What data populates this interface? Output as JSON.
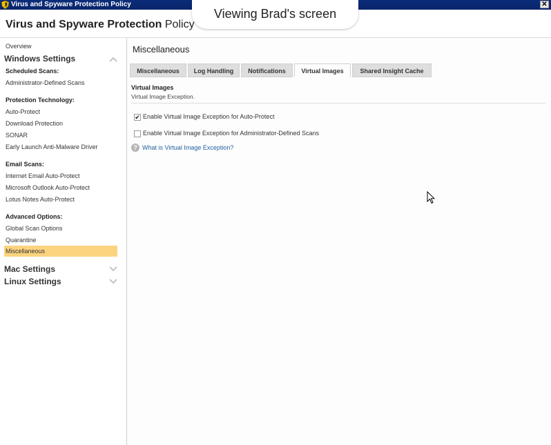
{
  "window": {
    "title": "Virus and Spyware Protection Policy",
    "close_glyph": "✕"
  },
  "header": {
    "title_bold": "Virus and Spyware Protection",
    "title_rest": " Policy"
  },
  "overlay": {
    "viewing_text": "Viewing Brad's screen"
  },
  "sidebar": {
    "overview": "Overview",
    "windows_settings": "Windows Settings",
    "scheduled_scans_head": "Scheduled Scans:",
    "admin_defined_scans": "Administrator-Defined Scans",
    "protection_tech_head": "Protection Technology:",
    "auto_protect": "Auto-Protect",
    "download_protection": "Download Protection",
    "sonar": "SONAR",
    "elam": "Early Launch Anti-Malware Driver",
    "email_scans_head": "Email Scans:",
    "internet_email": "Internet Email Auto-Protect",
    "outlook": "Microsoft Outlook Auto-Protect",
    "lotus": "Lotus Notes Auto-Protect",
    "advanced_head": "Advanced Options:",
    "global_scan": "Global Scan Options",
    "quarantine": "Quarantine",
    "miscellaneous": "Miscellaneous",
    "mac_settings": "Mac Settings",
    "linux_settings": "Linux Settings"
  },
  "main": {
    "heading": "Miscellaneous",
    "tabs": [
      {
        "label": "Miscellaneous"
      },
      {
        "label": "Log Handling"
      },
      {
        "label": "Notifications"
      },
      {
        "label": "Virtual Images"
      },
      {
        "label": "Shared Insight Cache"
      }
    ],
    "active_tab": "Virtual Images",
    "section_title": "Virtual Images",
    "section_desc": "Virtual Image Exception.",
    "checkbox_auto_protect": {
      "label": "Enable Virtual Image Exception for Auto-Protect",
      "checked": true
    },
    "checkbox_admin_scans": {
      "label": "Enable Virtual Image Exception for Administrator-Defined Scans",
      "checked": false
    },
    "help_link": "What is Virtual Image Exception?",
    "check_glyph": "✔",
    "help_glyph": "?"
  },
  "colors": {
    "titlebar": "#0a246a",
    "selected_item": "#fcd47f",
    "link": "#1f5f9e"
  }
}
